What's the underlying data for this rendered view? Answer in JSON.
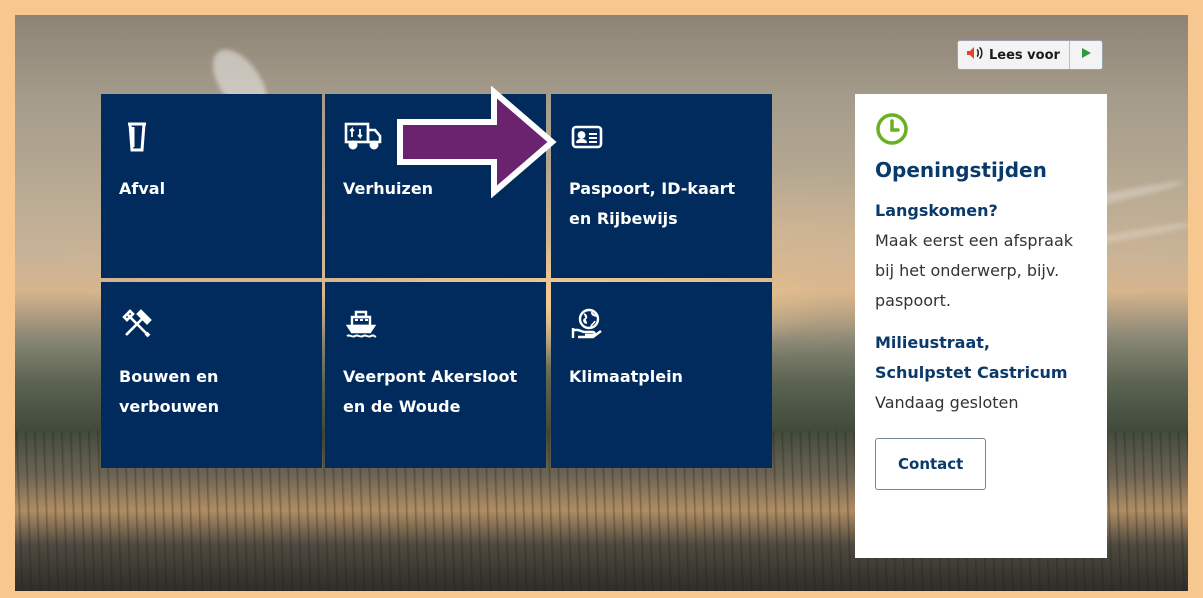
{
  "readspeaker": {
    "listen_label": "Lees voor",
    "speaker_icon": "speaker-icon",
    "play_icon": "play-icon"
  },
  "tiles": [
    {
      "label": "Afval",
      "icon": "trash-bin-icon"
    },
    {
      "label": "Verhuizen",
      "icon": "moving-truck-icon"
    },
    {
      "label": "Paspoort, ID-kaart en Rijbewijs",
      "icon": "id-card-icon"
    },
    {
      "label": "Bouwen en verbouwen",
      "icon": "hammer-tools-icon"
    },
    {
      "label": "Veerpont Akersloot en de Woude",
      "icon": "ferry-icon"
    },
    {
      "label": "Klimaatplein",
      "icon": "globe-in-hand-icon"
    }
  ],
  "opening": {
    "icon": "clock-icon",
    "title": "Openingstijden",
    "visit_heading": "Langskomen?",
    "visit_text": "Maak eerst een afspraak bij het onderwerp, bijv. paspoort.",
    "location_heading": "Milieustraat, Schulpstet Castricum",
    "location_status": "Vandaag gesloten",
    "contact_label": "Contact"
  },
  "annotation": {
    "icon": "arrow-right-icon"
  },
  "colors": {
    "tile_bg": "#002b5c",
    "accent_green": "#6ab023",
    "arrow_purple": "#6b2370",
    "frame": "#f6c78e"
  }
}
